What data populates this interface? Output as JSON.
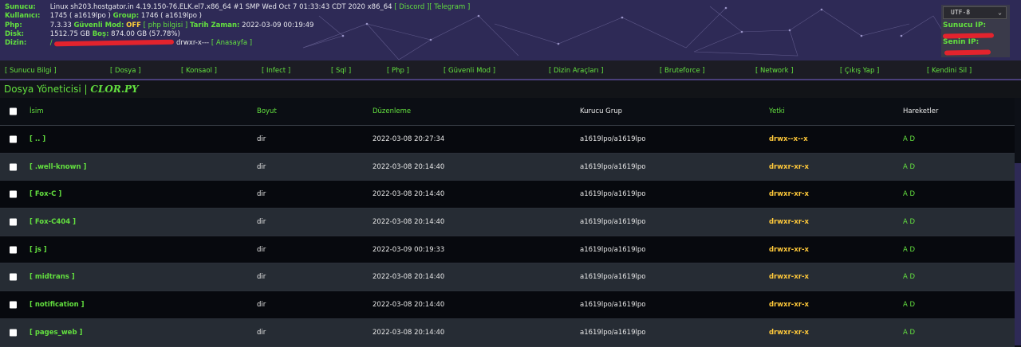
{
  "header": {
    "server_label": "Sunucu:",
    "server_value": "Linux sh203.hostgator.in 4.19.150-76.ELK.el7.x86_64 #1 SMP Wed Oct 7 01:33:43 CDT 2020 x86_64",
    "discord_link": "[ Discord ]",
    "telegram_link": "[ Telegram ]",
    "user_label": "Kullanıcı:",
    "user_value": "1745 ( a1619lpo )",
    "group_label": "Group:",
    "group_value": "1746 ( a1619lpo )",
    "php_label": "Php:",
    "php_value": "7.3.33",
    "safe_mode_label": "Güvenli Mod:",
    "safe_mode_value": "OFF",
    "php_info_link": "[ php bilgisi ]",
    "datetime_label": "Tarih Zaman:",
    "datetime_value": "2022-03-09 00:19:49",
    "disk_label": "Disk:",
    "disk_value": "1512.75 GB",
    "free_label": "Boş:",
    "free_value": "874.00 GB (57.78%)",
    "dir_label": "Dizin:",
    "dir_prefix": "/",
    "dir_perm": "drwxr-x---",
    "home_link": "[ Anasayfa ]",
    "encoding": "UTF-8",
    "server_ip_label": "Sunucu IP:",
    "your_ip_label": "Senin IP:"
  },
  "menu": [
    "[ Sunucu Bilgi ]",
    "[ Dosya ]",
    "[ Konsaol ]",
    "[ Infect ]",
    "[ Sql ]",
    "[ Php ]",
    "[ Güvenli Mod ]",
    "[ Dizin Araçları ]",
    "[ Bruteforce ]",
    "[ Network ]",
    "[ Çıkış Yap ]",
    "[ Kendini Sil ]"
  ],
  "title": {
    "main": "Dosya Yöneticisi |",
    "brand": "CLOR.PY"
  },
  "table": {
    "headers": {
      "name": "İsim",
      "size": "Boyut",
      "modified": "Düzenleme",
      "owner": "Kurucu Grup",
      "perm": "Yetki",
      "actions": "Hareketler"
    },
    "rows": [
      {
        "name": "[ .. ]",
        "size": "dir",
        "modified": "2022-03-08 20:27:34",
        "owner": "a1619lpo/a1619lpo",
        "perm": "drwx--x--x",
        "actions": "A D"
      },
      {
        "name": "[ .well-known ]",
        "size": "dir",
        "modified": "2022-03-08 20:14:40",
        "owner": "a1619lpo/a1619lpo",
        "perm": "drwxr-xr-x",
        "actions": "A D"
      },
      {
        "name": "[ Fox-C ]",
        "size": "dir",
        "modified": "2022-03-08 20:14:40",
        "owner": "a1619lpo/a1619lpo",
        "perm": "drwxr-xr-x",
        "actions": "A D"
      },
      {
        "name": "[ Fox-C404 ]",
        "size": "dir",
        "modified": "2022-03-08 20:14:40",
        "owner": "a1619lpo/a1619lpo",
        "perm": "drwxr-xr-x",
        "actions": "A D"
      },
      {
        "name": "[ js ]",
        "size": "dir",
        "modified": "2022-03-09 00:19:33",
        "owner": "a1619lpo/a1619lpo",
        "perm": "drwxr-xr-x",
        "actions": "A D"
      },
      {
        "name": "[ midtrans ]",
        "size": "dir",
        "modified": "2022-03-08 20:14:40",
        "owner": "a1619lpo/a1619lpo",
        "perm": "drwxr-xr-x",
        "actions": "A D"
      },
      {
        "name": "[ notification ]",
        "size": "dir",
        "modified": "2022-03-08 20:14:40",
        "owner": "a1619lpo/a1619lpo",
        "perm": "drwxr-xr-x",
        "actions": "A D"
      },
      {
        "name": "[ pages_web ]",
        "size": "dir",
        "modified": "2022-03-08 20:14:40",
        "owner": "a1619lpo/a1619lpo",
        "perm": "drwxr-xr-x",
        "actions": "A D"
      }
    ]
  }
}
